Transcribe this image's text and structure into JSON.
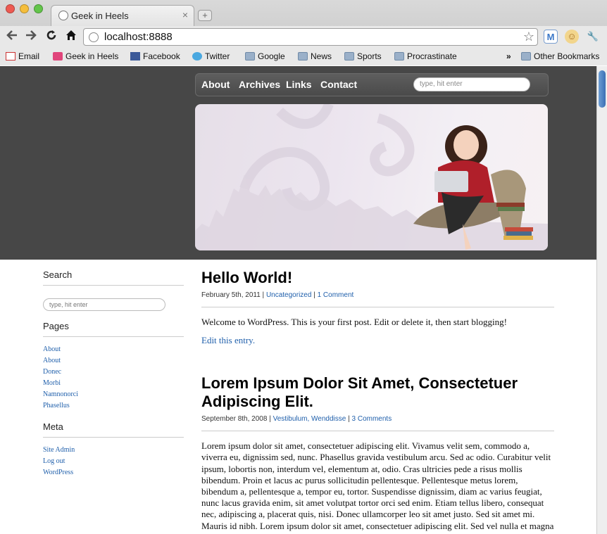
{
  "browser": {
    "tab_title": "Geek in Heels",
    "tab_close": "×",
    "new_tab": "+",
    "url": "localhost:8888",
    "nav_icons": {
      "back": "back-arrow-icon",
      "forward": "forward-arrow-icon",
      "reload": "reload-icon",
      "home": "home-icon",
      "star": "star-icon",
      "mail": "gmail-icon",
      "ext": "extension-icon",
      "wrench": "wrench-icon"
    }
  },
  "bookmarks": [
    {
      "label": "Email",
      "icon": "gmail-icon"
    },
    {
      "label": "Geek in Heels",
      "icon": "book-icon"
    },
    {
      "label": "Facebook",
      "icon": "facebook-icon"
    },
    {
      "label": "Twitter",
      "icon": "twitter-icon"
    },
    {
      "label": "Google",
      "icon": "folder-icon"
    },
    {
      "label": "News",
      "icon": "folder-icon"
    },
    {
      "label": "Sports",
      "icon": "folder-icon"
    },
    {
      "label": "Procrastinate",
      "icon": "folder-icon"
    }
  ],
  "bookmarks_overflow": "»",
  "other_bookmarks": "Other Bookmarks",
  "site": {
    "nav": [
      "About",
      "Archives",
      "Links",
      "Contact"
    ],
    "search_placeholder": "type, hit enter"
  },
  "sidebar": {
    "search_heading": "Search",
    "search_placeholder": "type, hit enter",
    "pages_heading": "Pages",
    "pages": [
      "About",
      "About",
      "Donec",
      "Morbi",
      "Namnonorci",
      "Phasellus"
    ],
    "meta_heading": "Meta",
    "meta": [
      "Site Admin",
      "Log out",
      "WordPress"
    ]
  },
  "posts": [
    {
      "title": "Hello World!",
      "date": "February 5th, 2011",
      "categories": "Uncategorized",
      "comments": "1 Comment",
      "sep": "|",
      "body": "Welcome to WordPress. This is your first post. Edit or delete it, then start blogging!",
      "edit": "Edit this entry."
    },
    {
      "title": "Lorem Ipsum Dolor Sit Amet, Consectetuer Adipiscing Elit.",
      "date": "September 8th, 2008",
      "categories": "Vestibulum, Wenddisse",
      "comments": "3 Comments",
      "sep": "|",
      "body": "Lorem ipsum dolor sit amet, consectetuer adipiscing elit. Vivamus velit sem, commodo a, viverra eu, dignissim sed, nunc. Phasellus gravida vestibulum arcu. Sed ac odio. Curabitur velit ipsum, lobortis non, interdum vel, elementum at, odio. Cras ultricies pede a risus mollis bibendum. Proin et lacus ac purus sollicitudin pellentesque. Pellentesque metus lorem, bibendum a, pellentesque a, tempor eu, tortor. Suspendisse dignissim, diam ac varius feugiat, nunc lacus gravida enim, sit amet volutpat tortor orci sed enim. Etiam tellus libero, consequat nec, adipiscing a, placerat quis, nisi. Donec ullamcorper leo sit amet justo. Sed sit amet mi. Mauris id nibh. Lorem ipsum dolor sit amet, consectetuer adipiscing elit. Sed vel nulla et magna consectetuer auctor."
    }
  ],
  "colors": {
    "header_bg": "#474747",
    "link": "#1f5fab"
  }
}
